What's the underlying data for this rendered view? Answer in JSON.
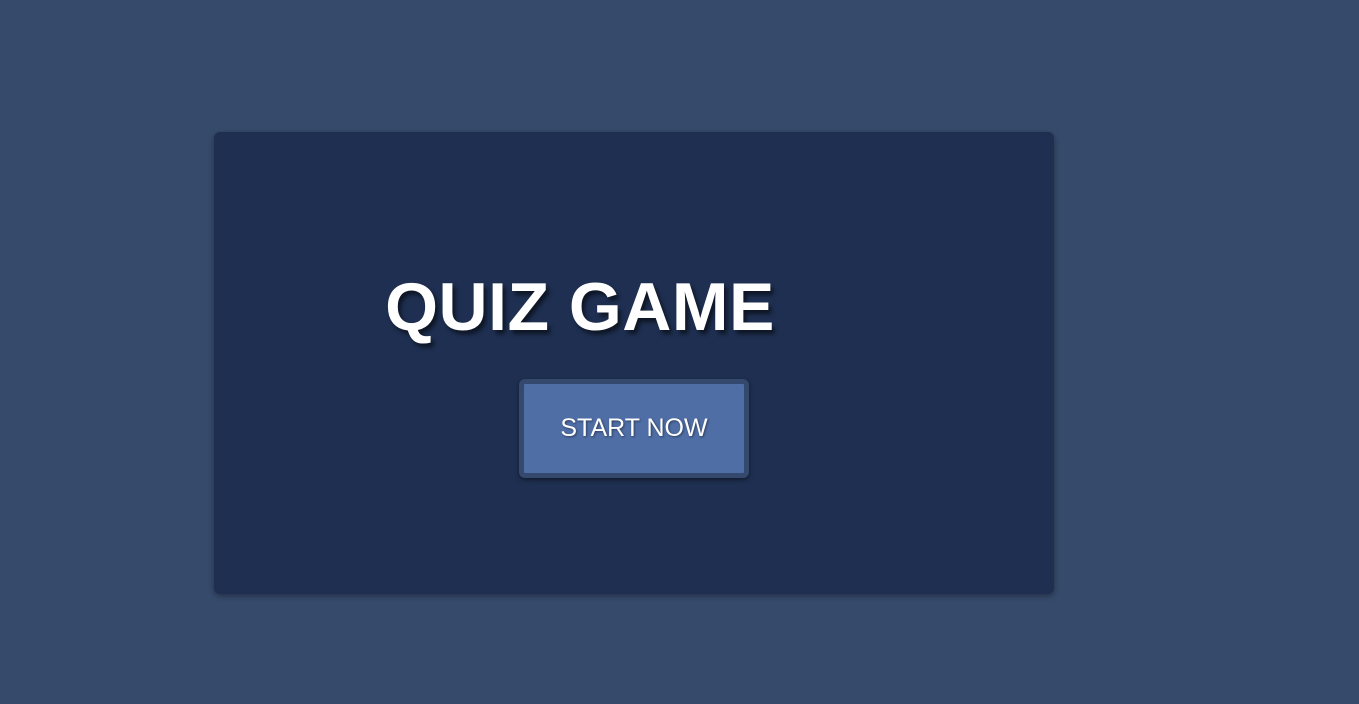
{
  "game": {
    "title": "QUIZ GAME",
    "start_label": "START NOW"
  },
  "colors": {
    "page_background": "#364a6b",
    "card_background": "#1e2f51",
    "button_background": "#4f6ea6",
    "button_border": "#34496d",
    "text": "#ffffff"
  }
}
